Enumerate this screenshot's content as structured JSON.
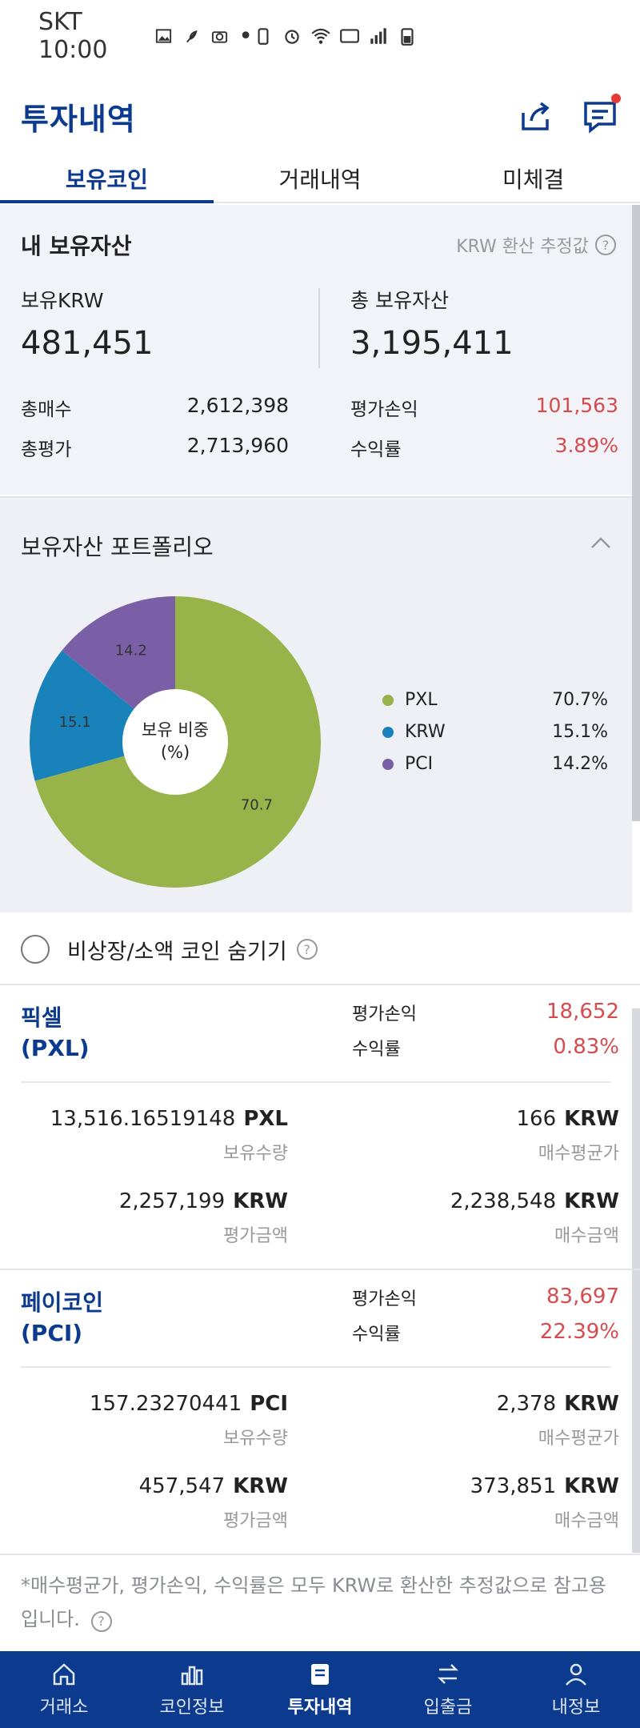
{
  "status_bar": {
    "carrier_time": "SKT 10:00"
  },
  "header": {
    "title": "투자내역"
  },
  "tabs": [
    {
      "label": "보유코인",
      "active": true
    },
    {
      "label": "거래내역",
      "active": false
    },
    {
      "label": "미체결",
      "active": false
    }
  ],
  "summary": {
    "title": "내 보유자산",
    "krw_note": "KRW 환산 추정값",
    "holding_krw_label": "보유KRW",
    "holding_krw_value": "481,451",
    "total_assets_label": "총 보유자산",
    "total_assets_value": "3,195,411",
    "total_buy_label": "총매수",
    "total_buy_value": "2,612,398",
    "total_eval_label": "총평가",
    "total_eval_value": "2,713,960",
    "eval_pl_label": "평가손익",
    "eval_pl_value": "101,563",
    "return_label": "수익률",
    "return_value": "3.89%"
  },
  "portfolio": {
    "title": "보유자산 포트폴리오",
    "center_label_1": "보유 비중",
    "center_label_2": "(%)",
    "legend": [
      {
        "name": "PXL",
        "pct": "70.7%"
      },
      {
        "name": "KRW",
        "pct": "15.1%"
      },
      {
        "name": "PCI",
        "pct": "14.2%"
      }
    ]
  },
  "chart_data": {
    "type": "pie",
    "categories": [
      "PXL",
      "KRW",
      "PCI"
    ],
    "values": [
      70.7,
      15.1,
      14.2
    ],
    "colors": [
      "#97b34a",
      "#1a82ba",
      "#7b5fa6"
    ],
    "donut": true,
    "legend_position": "right"
  },
  "hide_toggle": {
    "label": "비상장/소액 코인 숨기기",
    "checked": false
  },
  "coins": [
    {
      "name_line1": "픽셀",
      "name_line2": "(PXL)",
      "eval_pl_label": "평가손익",
      "eval_pl_value": "18,652",
      "return_label": "수익률",
      "return_value": "0.83%",
      "qty_value": "13,516.16519148",
      "qty_unit": "PXL",
      "qty_label": "보유수량",
      "avg_value": "166",
      "avg_unit": "KRW",
      "avg_label": "매수평균가",
      "eval_value": "2,257,199",
      "eval_unit": "KRW",
      "eval_label": "평가금액",
      "buy_value": "2,238,548",
      "buy_unit": "KRW",
      "buy_label": "매수금액"
    },
    {
      "name_line1": "페이코인",
      "name_line2": "(PCI)",
      "eval_pl_label": "평가손익",
      "eval_pl_value": "83,697",
      "return_label": "수익률",
      "return_value": "22.39%",
      "qty_value": "157.23270441",
      "qty_unit": "PCI",
      "qty_label": "보유수량",
      "avg_value": "2,378",
      "avg_unit": "KRW",
      "avg_label": "매수평균가",
      "eval_value": "457,547",
      "eval_unit": "KRW",
      "eval_label": "평가금액",
      "buy_value": "373,851",
      "buy_unit": "KRW",
      "buy_label": "매수금액"
    }
  ],
  "footer_note": "*매수평균가, 평가손익, 수익률은 모두 KRW로 환산한 추정값으로 참고용입니다.",
  "bottom_nav": [
    {
      "label": "거래소",
      "icon": "home-icon",
      "active": false
    },
    {
      "label": "코인정보",
      "icon": "bar-chart-icon",
      "active": false
    },
    {
      "label": "투자내역",
      "icon": "document-icon",
      "active": true
    },
    {
      "label": "입출금",
      "icon": "transfer-icon",
      "active": false
    },
    {
      "label": "내정보",
      "icon": "user-icon",
      "active": false
    }
  ],
  "colors": {
    "brand": "#0b3a8f",
    "loss_gain_red": "#d64c4c"
  }
}
